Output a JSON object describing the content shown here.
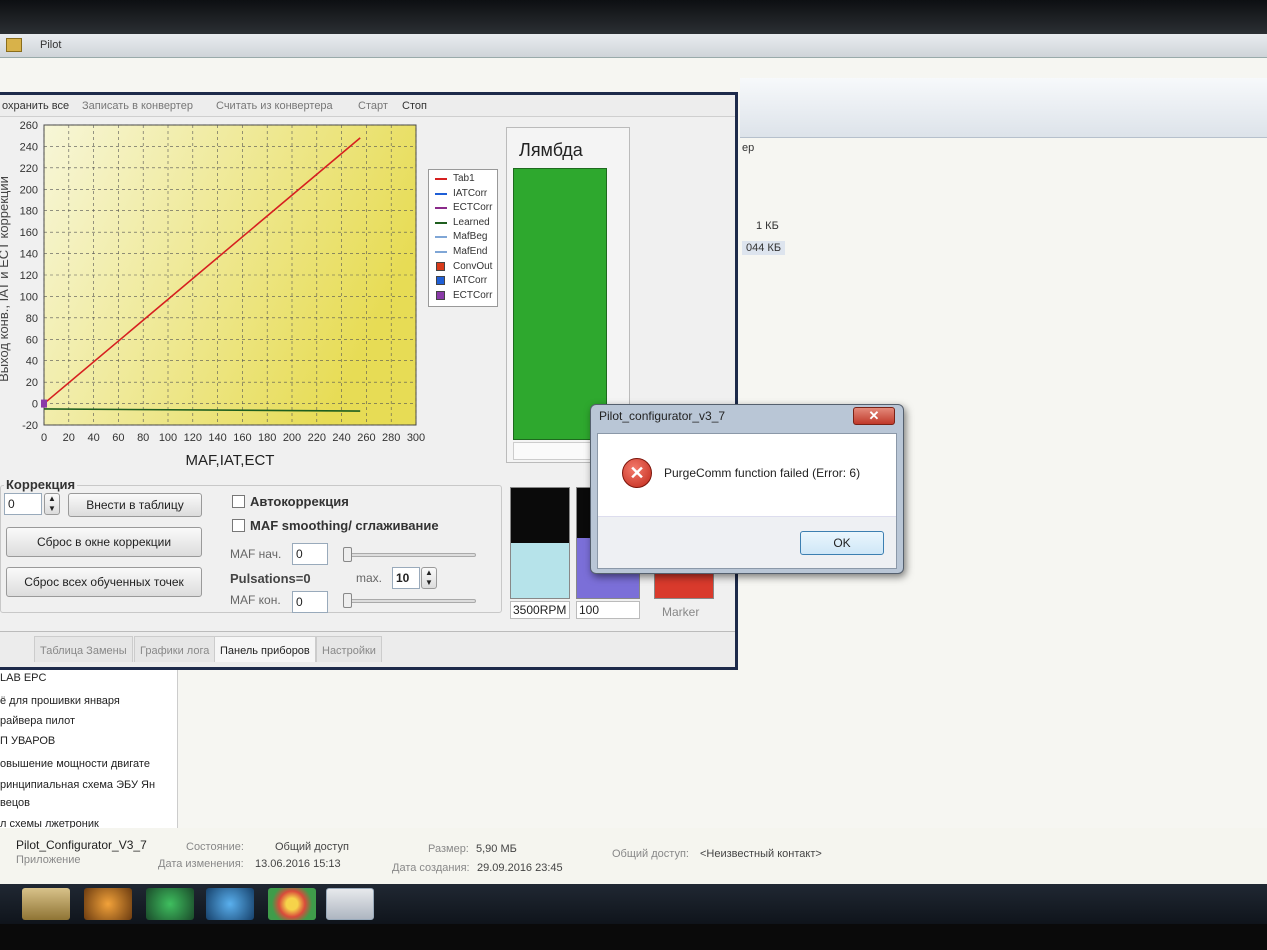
{
  "explorer": {
    "breadcrumb": "Pilot",
    "column_header": "ер",
    "sizes": [
      "1 КБ",
      "044 КБ"
    ],
    "nav_items": [
      "LAB EPC",
      "ё для прошивки января",
      "райвера пилот",
      "П УВАРОВ",
      "овышение мощности двигате",
      "ринципиальная схема ЭБУ Ян",
      "вецов",
      "л схемы лжетроник"
    ],
    "details": {
      "name": "Pilot_Configurator_V3_7",
      "type": "Приложение",
      "state_label": "Состояние:",
      "state_value": "Общий доступ",
      "modified_label": "Дата изменения:",
      "modified_value": "13.06.2016 15:13",
      "size_label": "Размер:",
      "size_value": "5,90 МБ",
      "created_label": "Дата создания:",
      "created_value": "29.09.2016 23:45",
      "share_label": "Общий доступ:",
      "share_value": "<Неизвестный контакт>"
    }
  },
  "app": {
    "menu": [
      "охранить все",
      "Записать в конвертер",
      "Считать из конвертера",
      "Старт",
      "Стоп"
    ],
    "lambda_title": "Лямбда",
    "correction": {
      "title": "Коррекция",
      "spin_value": "0",
      "apply_button": "Внести в таблицу",
      "reset_window_button": "Сброс в окне коррекции",
      "reset_all_button": "Сброс всех обученных точек",
      "autocorr_label": "Автокоррекция",
      "maf_smoothing_label": "MAF smoothing/ сглаживание",
      "maf_start_label": "MAF нач.",
      "maf_start_value": "0",
      "pulsations_label": "Pulsations=0",
      "max_label": "max.",
      "max_value": "10",
      "maf_end_label": "MAF кон.",
      "maf_end_value": "0"
    },
    "gauges": {
      "rpm_label": "3500RPM",
      "second_label": "100",
      "marker_label": "Marker",
      "rpm_fill": 0.5,
      "second_fill": 0.55
    },
    "tabs": [
      "Таблица Замены",
      "Графики лога",
      "Панель приборов",
      "Настройки"
    ],
    "active_tab": "Панель приборов"
  },
  "chart_data": {
    "type": "line",
    "xlabel": "MAF,IAT,ECT",
    "ylabel": "Выход конв., IAT и ECT коррекции",
    "xlim": [
      0,
      300
    ],
    "ylim": [
      -20,
      260
    ],
    "x_ticks": [
      "0",
      "20",
      "40",
      "60",
      "80",
      "100",
      "120",
      "140",
      "160",
      "180",
      "200",
      "220",
      "240",
      "260",
      "280",
      "300"
    ],
    "y_ticks": [
      "260",
      "240",
      "220",
      "200",
      "180",
      "160",
      "140",
      "120",
      "100",
      "80",
      "60",
      "40",
      "20",
      "0",
      "-20"
    ],
    "grid": true,
    "legend_position": "right",
    "legend": [
      {
        "name": "Tab1",
        "color": "#d62020",
        "kind": "line"
      },
      {
        "name": "IATCorr",
        "color": "#1f5fd6",
        "kind": "line"
      },
      {
        "name": "ECTCorr",
        "color": "#8a2a8a",
        "kind": "line"
      },
      {
        "name": "Learned",
        "color": "#1e5e1e",
        "kind": "line"
      },
      {
        "name": "MafBeg",
        "color": "#7fa6d6",
        "kind": "line"
      },
      {
        "name": "MafEnd",
        "color": "#7fa6d6",
        "kind": "line"
      },
      {
        "name": "ConvOut",
        "color": "#d83a1a",
        "kind": "box"
      },
      {
        "name": "IATCorr",
        "color": "#1f5fd6",
        "kind": "box"
      },
      {
        "name": "ECTCorr",
        "color": "#8a3aa8",
        "kind": "box"
      }
    ],
    "series": [
      {
        "name": "Tab1",
        "x": [
          0,
          255
        ],
        "y": [
          0,
          248
        ]
      },
      {
        "name": "Learned",
        "x": [
          0,
          255
        ],
        "y": [
          -5,
          -7
        ]
      }
    ]
  },
  "dialog": {
    "title": "Pilot_configurator_v3_7",
    "close": "✕",
    "icon": "✕",
    "message": "PurgeComm function failed (Error: 6)",
    "ok_button": "OK"
  }
}
